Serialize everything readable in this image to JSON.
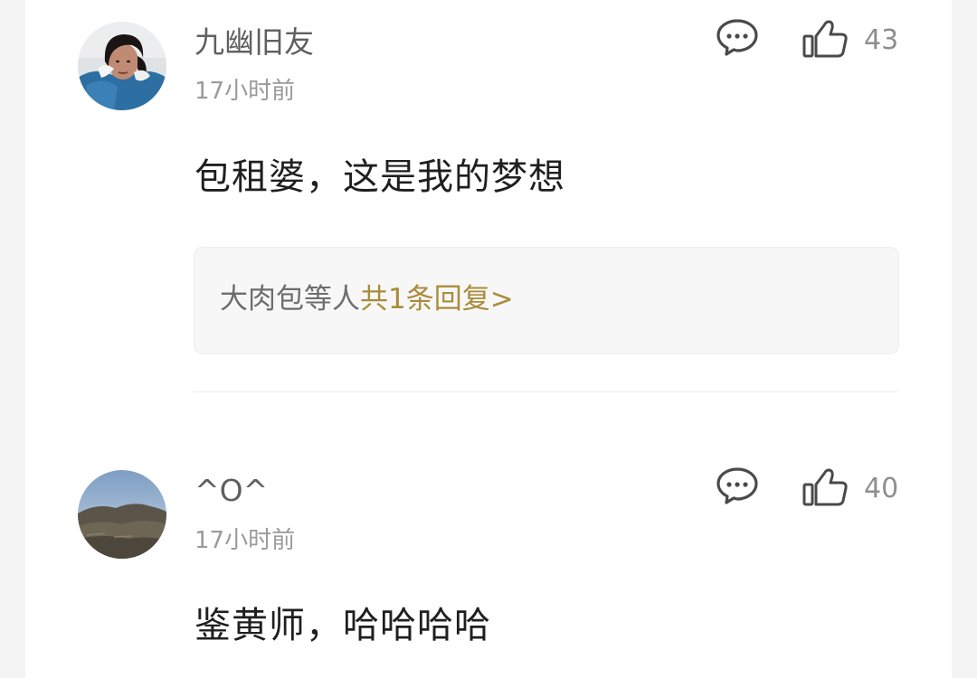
{
  "comments": [
    {
      "username": "九幽旧友",
      "time": "17小时前",
      "content": "包租婆，这是我的梦想",
      "like_count": "43",
      "avatar_icon": "portrait-photo",
      "replies": {
        "names": "大肉包",
        "etc": "等人",
        "link": "共1条回复>"
      }
    },
    {
      "username": "^O^",
      "time": "17小时前",
      "content": "鉴黄师，哈哈哈哈",
      "like_count": "40",
      "avatar_icon": "mountain-photo"
    }
  ],
  "icons": {
    "reply": "speech-bubble-icon",
    "like": "thumbs-up-icon"
  },
  "colors": {
    "accent": "#a98c3c",
    "username": "#5f5f5f",
    "meta": "#9a9a9a"
  }
}
